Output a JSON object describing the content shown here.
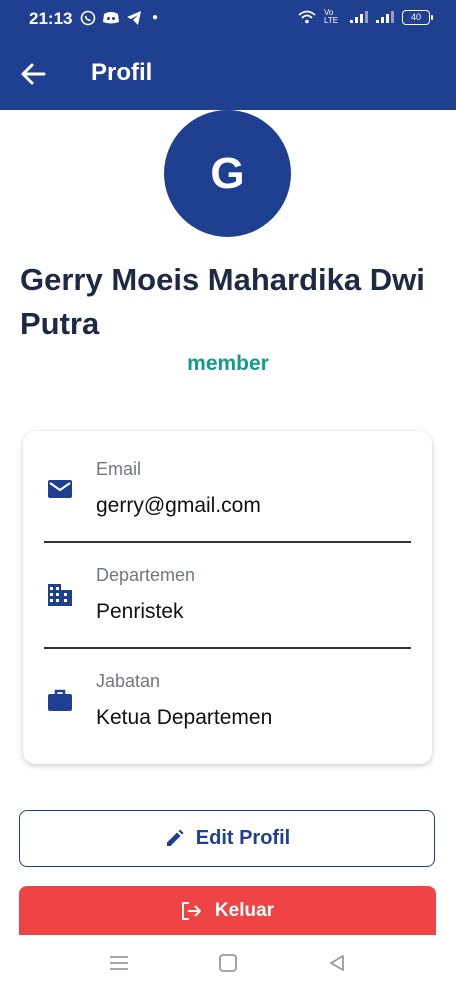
{
  "status_bar": {
    "time": "21:13",
    "battery": "40",
    "network_label": "Vo LTE"
  },
  "app_bar": {
    "title": "Profil",
    "back_icon": "arrow-left-icon"
  },
  "profile": {
    "avatar_initial": "G",
    "name": "Gerry Moeis Mahardika Dwi Putra",
    "role": "member"
  },
  "details": [
    {
      "icon": "mail-icon",
      "label": "Email",
      "value": "gerry@gmail.com"
    },
    {
      "icon": "building-icon",
      "label": "Departemen",
      "value": "Penristek"
    },
    {
      "icon": "briefcase-icon",
      "label": "Jabatan",
      "value": "Ketua Departemen"
    }
  ],
  "actions": {
    "edit_label": "Edit Profil",
    "logout_label": "Keluar"
  },
  "colors": {
    "primary": "#1f3f91",
    "role_green": "#139d86",
    "danger": "#ef4444"
  }
}
